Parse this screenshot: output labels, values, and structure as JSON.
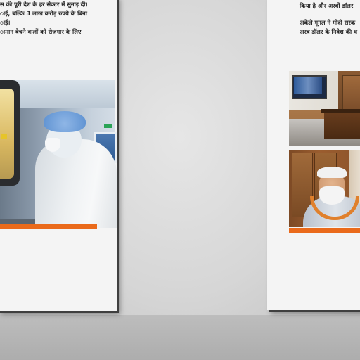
{
  "left_page": {
    "lines": [
      "स की पूरी देश के हर सेक्टर में सुनाइ दी।",
      "ाई, बल्कि 3 लाख करोड़ रुपये के बिना",
      "ाई।",
      "ामान बेचने वालों को रोजगार के लिए"
    ]
  },
  "right_page": {
    "para1": [
      "किया है और अरबों डॉलर"
    ],
    "para2": [
      "अकेले गूगल ने मोदी सरक",
      "अरब डॉलर के निवेश की घ"
    ]
  },
  "colors": {
    "accent_bar": "#ea6a1b",
    "page_bg": "#f4f4f4",
    "wall_bg": "#d4d4d4"
  }
}
